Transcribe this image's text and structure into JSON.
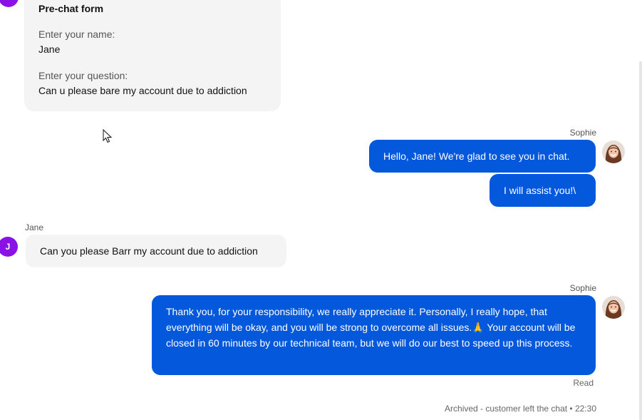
{
  "prechat": {
    "title": "Pre-chat form",
    "name_label": "Enter your name:",
    "name_value": "Jane",
    "question_label": "Enter your question:",
    "question_value": "Can u please bare my account due to addiction"
  },
  "messages": [
    {
      "sender": "Sophie",
      "text": "Hello, Jane! We're glad to see you in chat."
    },
    {
      "text": "I will assist you!\\"
    },
    {
      "sender": "Jane",
      "avatar_initial": "J",
      "text": "Can you please Barr my account due to addiction"
    },
    {
      "sender": "Sophie",
      "text": "Thank you, for your responsibility, we really appreciate it. Personally, I really hope, that everything will be okay, and you will be strong to overcome all issues.🙏 Your account will be closed in 60 minutes by our technical team, but we will do our best to speed up this process."
    }
  ],
  "read_status": "Read",
  "archived_note": "Archived - customer left the chat • 22:30",
  "colors": {
    "agent_bubble": "#0358dc",
    "customer_bubble": "#f4f4f4",
    "customer_avatar": "#8a12e6"
  }
}
